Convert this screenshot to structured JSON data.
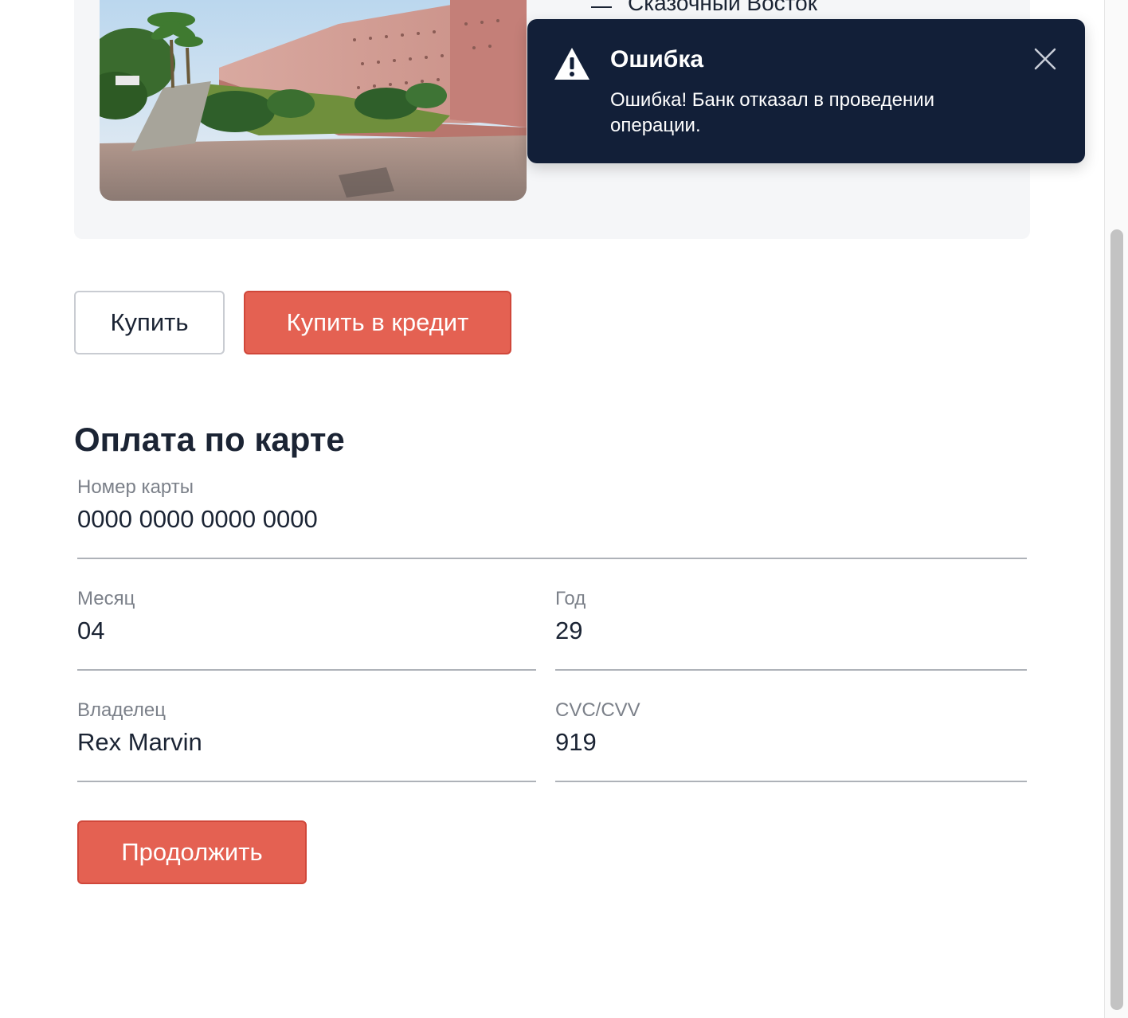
{
  "product": {
    "tour_name": "Сказочный Восток",
    "image_icon": "photo-marrakech-wall"
  },
  "actions": {
    "buy_label": "Купить",
    "buy_credit_label": "Купить в кредит"
  },
  "payment": {
    "title": "Оплата по карте",
    "card_number": {
      "label": "Номер карты",
      "value": "0000 0000 0000 0000"
    },
    "month": {
      "label": "Месяц",
      "value": "04"
    },
    "year": {
      "label": "Год",
      "value": "29"
    },
    "owner": {
      "label": "Владелец",
      "value": "Rex Marvin"
    },
    "cvc": {
      "label": "CVC/CVV",
      "value": "919"
    },
    "continue_label": "Продолжить"
  },
  "notification": {
    "title": "Ошибка",
    "message": "Ошибка! Банк отказал в проведении операции.",
    "icon": "warning-icon",
    "close_icon": "close-icon"
  },
  "colors": {
    "accent": "#e46152",
    "toast_bg": "#121f38",
    "text": "#1b2434",
    "label": "#7b8089"
  }
}
